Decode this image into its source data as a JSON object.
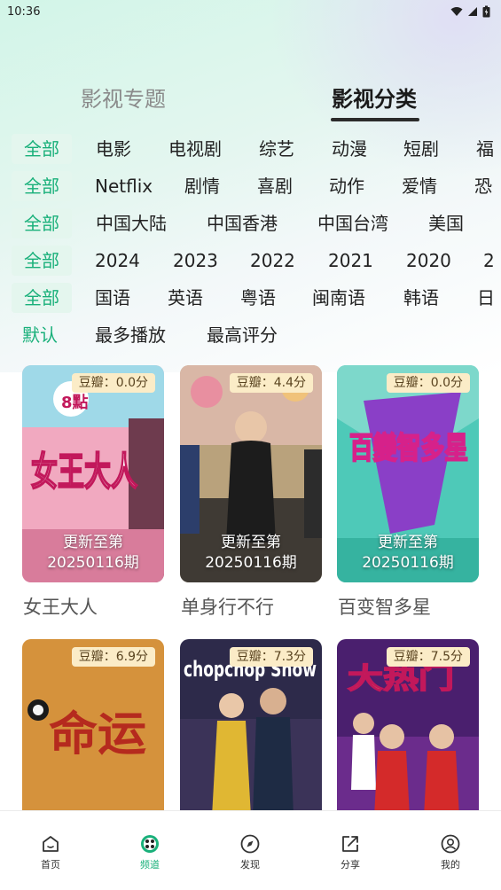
{
  "status": {
    "time": "10:36"
  },
  "top_tabs": [
    {
      "label": "影视专题"
    },
    {
      "label": "影视分类"
    }
  ],
  "filters": {
    "type": [
      "全部",
      "电影",
      "电视剧",
      "综艺",
      "动漫",
      "短剧",
      "福"
    ],
    "genre": [
      "全部",
      "Netflix",
      "剧情",
      "喜剧",
      "动作",
      "爱情",
      "恐"
    ],
    "region": [
      "全部",
      "中国大陆",
      "中国香港",
      "中国台湾",
      "美国"
    ],
    "year": [
      "全部",
      "2024",
      "2023",
      "2022",
      "2021",
      "2020",
      "2"
    ],
    "language": [
      "全部",
      "国语",
      "英语",
      "粤语",
      "闽南语",
      "韩语",
      "日"
    ],
    "sort": [
      "默认",
      "最多播放",
      "最高评分"
    ]
  },
  "cards": [
    {
      "title": "女王大人",
      "rating": "豆瓣：0.0分",
      "update_line1": "更新至第",
      "update_line2": "20250116期"
    },
    {
      "title": "单身行不行",
      "rating": "豆瓣：4.4分",
      "update_line1": "更新至第",
      "update_line2": "20250116期"
    },
    {
      "title": "百变智多星",
      "rating": "豆瓣：0.0分",
      "update_line1": "更新至第",
      "update_line2": "20250116期"
    },
    {
      "title": "",
      "rating": "豆瓣：6.9分",
      "update_line1": "",
      "update_line2": ""
    },
    {
      "title": "",
      "rating": "豆瓣：7.3分",
      "update_line1": "",
      "update_line2": ""
    },
    {
      "title": "",
      "rating": "豆瓣：7.5分",
      "update_line1": "",
      "update_line2": ""
    }
  ],
  "poster_art": {
    "card0": {
      "logo": "女王大人",
      "tag": "8點"
    },
    "card1": {},
    "card2": {
      "logo": "百變智多星"
    },
    "card3": {
      "logo": "命运"
    },
    "card4": {
      "logo": "chopchop Show"
    },
    "card5": {
      "logo": "大热门"
    }
  },
  "bottom_nav": [
    {
      "label": "首页",
      "icon": "home-icon"
    },
    {
      "label": "频道",
      "icon": "channel-icon"
    },
    {
      "label": "发现",
      "icon": "compass-icon"
    },
    {
      "label": "分享",
      "icon": "share-icon"
    },
    {
      "label": "我的",
      "icon": "user-icon"
    }
  ],
  "colors": {
    "accent": "#19b07a",
    "badge_bg": "#fbecc7",
    "chip_active_bg": "#e4f6ee"
  }
}
